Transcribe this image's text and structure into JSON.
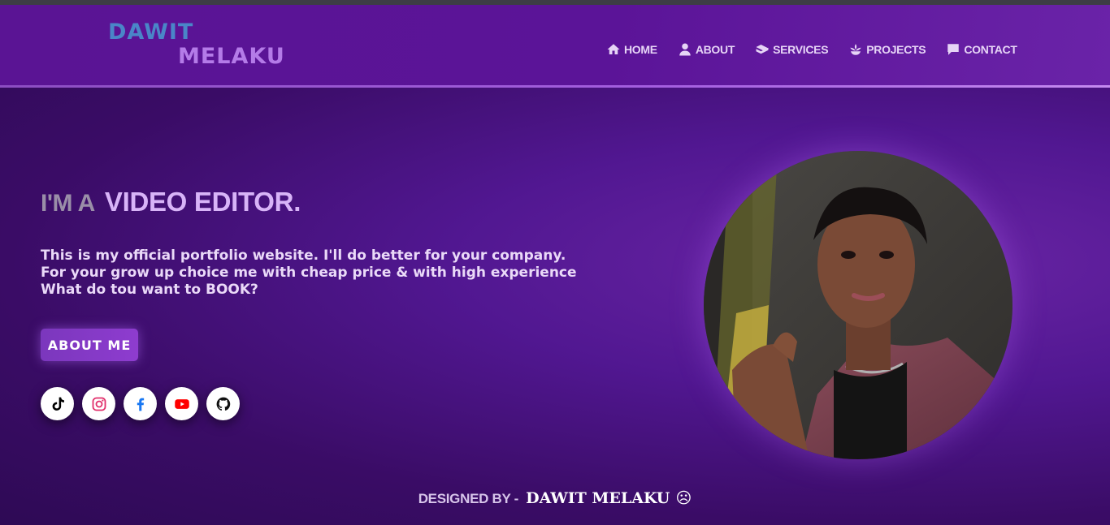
{
  "brand": {
    "first": "DAWIT",
    "last": "MELAKU",
    "first_color": "#4a86c8",
    "last_color": "#b47be8"
  },
  "nav": [
    {
      "label": "HOME",
      "icon": "home-icon"
    },
    {
      "label": "ABOUT",
      "icon": "user-icon"
    },
    {
      "label": "SERVICES",
      "icon": "services-icon"
    },
    {
      "label": "PROJECTS",
      "icon": "projects-icon"
    },
    {
      "label": "CONTACT",
      "icon": "chat-icon"
    }
  ],
  "hero": {
    "prefix": "I'M A",
    "role": "VIDEO EDITOR.",
    "intro_lines": [
      "This is my official portfolio website. I'll do better for your company.",
      "For your grow up choice me with cheap price & with high experience",
      "What do tou want to BOOK?"
    ],
    "button_label": "ABOUT ME"
  },
  "socials": [
    {
      "name": "tiktok-icon",
      "color": "#000000"
    },
    {
      "name": "instagram-icon",
      "color": "#e1306c"
    },
    {
      "name": "facebook-icon",
      "color": "#1877f2"
    },
    {
      "name": "youtube-icon",
      "color": "#ff0000"
    },
    {
      "name": "github-icon",
      "color": "#111111"
    }
  ],
  "footer": {
    "prefix": "DESIGNED BY -",
    "name": "DAWIT MELAKU",
    "emoji": "☹"
  },
  "colors": {
    "accent": "#d8b4f8",
    "header_bg": "#5a1494",
    "button_bg": "#8e3ccf"
  }
}
